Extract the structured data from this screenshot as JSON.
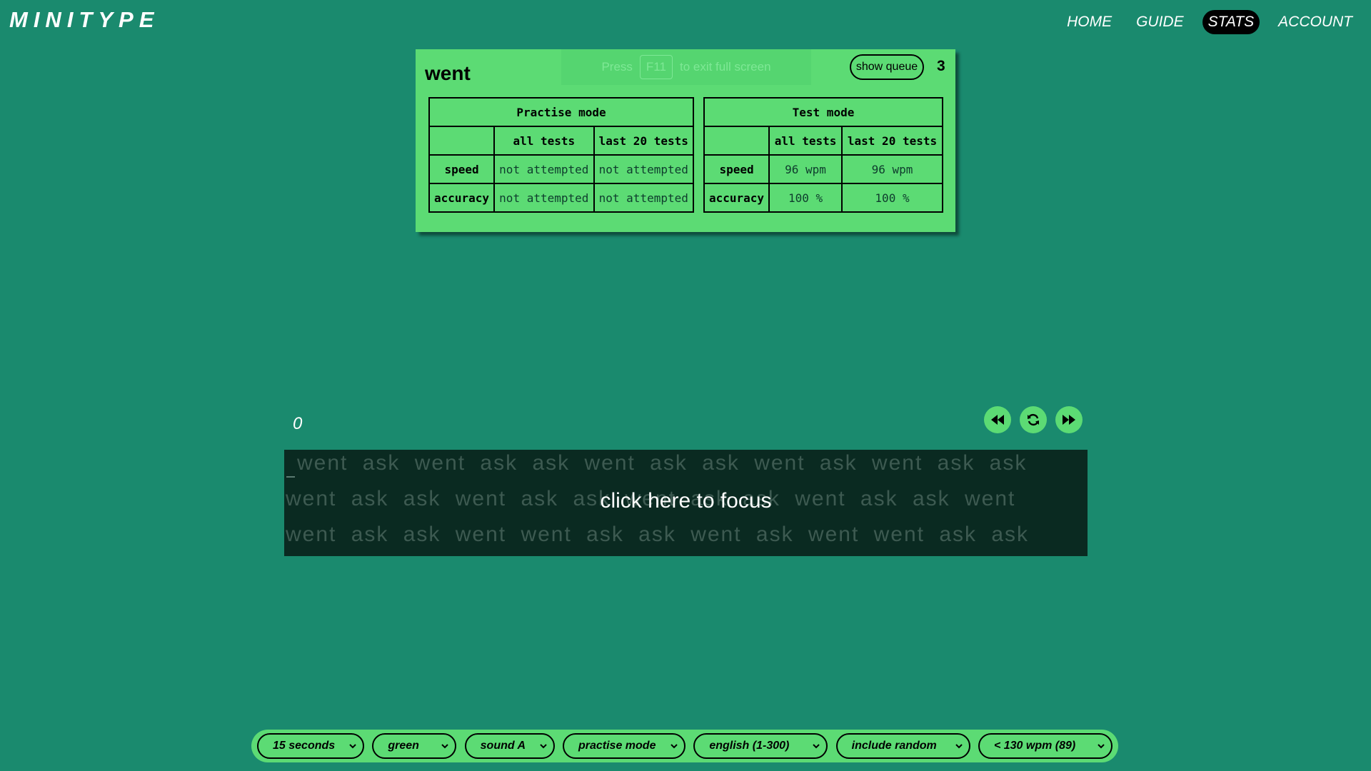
{
  "logo": "MINITYPE",
  "nav": {
    "items": [
      {
        "label": "HOME",
        "active": false
      },
      {
        "label": "GUIDE",
        "active": false
      },
      {
        "label": "STATS",
        "active": true
      },
      {
        "label": "ACCOUNT",
        "active": false
      }
    ]
  },
  "popup": {
    "word": "went",
    "fullscreen_hint": {
      "press": "Press",
      "key": "F11",
      "rest": "to exit full screen"
    },
    "show_queue_label": "show queue",
    "queue_count": "3",
    "practise": {
      "title": "Practise mode",
      "col_all": "all tests",
      "col_last": "last 20 tests",
      "speed_label": "speed",
      "speed_all": "not attempted",
      "speed_last": "not attempted",
      "accuracy_label": "accuracy",
      "accuracy_all": "not attempted",
      "accuracy_last": "not attempted"
    },
    "test": {
      "title": "Test mode",
      "col_all": "all tests",
      "col_last": "last 20 tests",
      "speed_label": "speed",
      "speed_all": "96 wpm",
      "speed_last": "96 wpm",
      "accuracy_label": "accuracy",
      "accuracy_all": "100 %",
      "accuracy_last": "100 %"
    }
  },
  "typing": {
    "word_count": "0",
    "lines": [
      "went ask went ask ask went ask ask went ask went ask ask",
      "went ask ask went ask ask went ask ask went ask ask went",
      "went ask ask went went ask ask went ask went went ask ask"
    ],
    "focus_message": "click here to focus"
  },
  "controls": {
    "back_icon": "rewind-icon",
    "restart_icon": "refresh-icon",
    "forward_icon": "fast-forward-icon"
  },
  "settings": {
    "duration": "15 seconds",
    "theme": "green",
    "sound": "sound A",
    "mode": "practise mode",
    "language": "english (1-300)",
    "random": "include random",
    "speed_filter": "< 130 wpm (89)"
  },
  "colors": {
    "background": "#1a8a6e",
    "accent": "#5cdb74",
    "text_box": "#0a2a21",
    "active_nav": "#000000"
  }
}
